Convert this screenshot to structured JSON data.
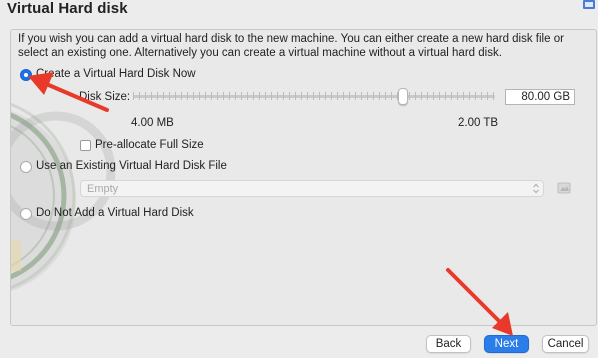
{
  "window": {
    "title": "Virtual Hard disk"
  },
  "description": "If you wish you can add a virtual hard disk to the new machine. You can either create a new hard disk file or select an existing one. Alternatively you can create a virtual machine without a virtual hard disk.",
  "options": {
    "create_now": {
      "label": "Create a Virtual Hard Disk Now",
      "selected": true
    },
    "use_existing": {
      "label": "Use an Existing Virtual Hard Disk File",
      "selected": false
    },
    "do_not_add": {
      "label": "Do Not Add a Virtual Hard Disk",
      "selected": false
    }
  },
  "disk": {
    "size_label": "Disk Size:",
    "size_value": "80.00 GB",
    "min_label": "4.00 MB",
    "max_label": "2.00 TB",
    "preallocate_label": "Pre-allocate Full Size",
    "preallocate_checked": false
  },
  "existing_file": {
    "placeholder": "Empty",
    "enabled": false
  },
  "buttons": {
    "back": "Back",
    "next": "Next",
    "cancel": "Cancel"
  },
  "colors": {
    "accent": "#2b7de9",
    "annotation_arrow": "#e8392b"
  },
  "icons": {
    "help": "help-icon",
    "folder": "folder-icon",
    "combo": "chevron-updown-icon"
  }
}
